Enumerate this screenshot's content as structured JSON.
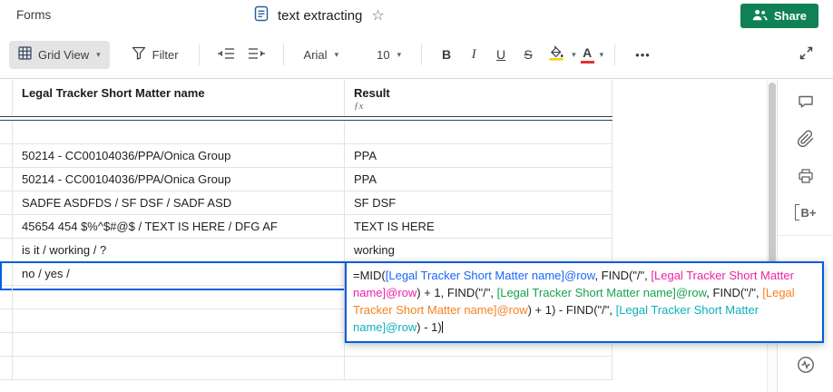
{
  "topbar": {
    "menu_forms": "Forms",
    "doc_title": "text extracting",
    "share_label": "Share"
  },
  "toolbar": {
    "grid_view": "Grid View",
    "filter": "Filter",
    "font_family": "Arial",
    "font_size": "10",
    "bold": "B",
    "italic": "I",
    "underline": "U",
    "strikethrough": "S",
    "more": "•••"
  },
  "icons": {
    "caret_down": "▾",
    "star": "☆",
    "text_color_letter": "A",
    "brandfolder_label": "B+"
  },
  "grid": {
    "col1_header": "Legal Tracker Short Matter name",
    "col2_header": "Result",
    "fx_label": "ƒx",
    "rows": [
      {
        "name": "",
        "result": "",
        "selected": false
      },
      {
        "name": "50214 - CC00104036/PPA/Onica Group",
        "result": "PPA",
        "selected": false
      },
      {
        "name": "50214 - CC00104036/PPA/Onica Group",
        "result": "PPA",
        "selected": false
      },
      {
        "name": "SADFE ASDFDS / SF DSF / SADF ASD",
        "result": "SF DSF",
        "selected": false
      },
      {
        "name": "45654 454 $%^$#@$ / TEXT IS HERE / DFG AF",
        "result": "TEXT IS HERE",
        "selected": false
      },
      {
        "name": "is it / working / ?",
        "result": "working",
        "selected": false
      },
      {
        "name": "no / yes /",
        "result": "",
        "selected": true
      },
      {
        "name": "",
        "result": "",
        "selected": false
      },
      {
        "name": "",
        "result": "",
        "selected": false
      },
      {
        "name": "",
        "result": "",
        "selected": false
      },
      {
        "name": "",
        "result": "",
        "selected": false
      }
    ]
  },
  "formula_editor": {
    "segments": [
      {
        "text": "=MID(",
        "color": "#202124"
      },
      {
        "text": "[Legal Tracker Short Matter name]@row",
        "color": "#1a66ff"
      },
      {
        "text": ", FIND(\"/\", ",
        "color": "#202124"
      },
      {
        "text": "[Legal Tracker Short Matter name]@row",
        "color": "#ef22a7"
      },
      {
        "text": ") + 1, FIND(\"/\", ",
        "color": "#202124"
      },
      {
        "text": "[Legal Tracker Short Matter name]@row",
        "color": "#18a24d"
      },
      {
        "text": ", FIND(\"/\", ",
        "color": "#202124"
      },
      {
        "text": "[Legal Tracker Short Matter name]@row",
        "color": "#f5821f"
      },
      {
        "text": ") + 1) - FIND(\"/\", ",
        "color": "#202124"
      },
      {
        "text": "[Legal Tracker Short Matter name]@row",
        "color": "#0cb0bd"
      },
      {
        "text": ") - 1)",
        "color": "#202124"
      }
    ]
  },
  "colors": {
    "share_green": "#0f8154",
    "selection_blue": "#005ee0",
    "header_divider_navy": "#31415f",
    "fill_swatch_yellow": "#f2d600",
    "text_color_red": "#e03131"
  }
}
